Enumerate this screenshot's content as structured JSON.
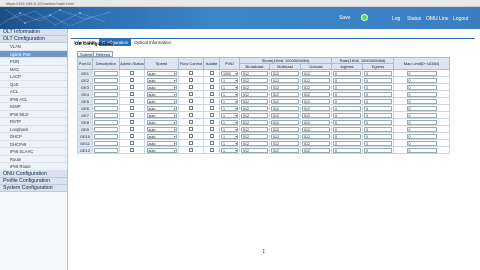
{
  "browser": {
    "url": "https://192.168.8.100/action/main.html"
  },
  "banner": {
    "state_label": "Save",
    "links": [
      "Log",
      "Status",
      "OMU Line",
      "Logout"
    ]
  },
  "sidebar": [
    {
      "label": "OLT Information",
      "type": "group"
    },
    {
      "label": "OLT Configuration",
      "type": "group"
    },
    {
      "label": "VLAN",
      "type": "item"
    },
    {
      "label": "Uplink Port",
      "type": "item",
      "active": true
    },
    {
      "label": "PON",
      "type": "item"
    },
    {
      "label": "MAC",
      "type": "item"
    },
    {
      "label": "LACP",
      "type": "item"
    },
    {
      "label": "QoS",
      "type": "item"
    },
    {
      "label": "ACL",
      "type": "item"
    },
    {
      "label": "IPv6 ACL",
      "type": "item"
    },
    {
      "label": "IGMP",
      "type": "item"
    },
    {
      "label": "IPv6 MLD",
      "type": "item"
    },
    {
      "label": "RSTP",
      "type": "item"
    },
    {
      "label": "Loopback",
      "type": "item"
    },
    {
      "label": "DHCP",
      "type": "item"
    },
    {
      "label": "DHCPv6",
      "type": "item"
    },
    {
      "label": "IPv6 SLAAC",
      "type": "item"
    },
    {
      "label": "Route",
      "type": "item"
    },
    {
      "label": "IPv6 Route",
      "type": "item"
    },
    {
      "label": "ONU Configuration",
      "type": "group"
    },
    {
      "label": "Profile Configuration",
      "type": "group"
    },
    {
      "label": "System Configuration",
      "type": "group"
    }
  ],
  "tabs": [
    {
      "label": "Information",
      "active": false
    },
    {
      "label": "Configuration",
      "active": true
    },
    {
      "label": "Optical Information",
      "active": false
    }
  ],
  "page_title": "GE Configuration",
  "buttons": {
    "submit": "Submit",
    "refresh": "Refresh"
  },
  "table": {
    "headers": [
      "Port ID",
      "Description",
      "Admin Status",
      "Speed",
      "Flow Control",
      "Isolate",
      "PVID",
      "Storm(1Kbit, 1000000Mbit)",
      "Rate(1Kbit, 1000000Mbit)",
      "Mac Limit(0~16384)"
    ],
    "subheaders": [
      "Broadcast",
      "Multicast",
      "Unicast",
      "Ingress",
      "Egress"
    ],
    "rows": [
      {
        "port": "GE1",
        "speed": "auto",
        "pvid": "1000",
        "bc": "512",
        "mc": "512",
        "uc": "512",
        "ing": "0",
        "egr": "0",
        "mac": "0"
      },
      {
        "port": "GE2",
        "speed": "auto",
        "pvid": "1",
        "bc": "512",
        "mc": "512",
        "uc": "512",
        "ing": "0",
        "egr": "0",
        "mac": "0"
      },
      {
        "port": "GE3",
        "speed": "auto",
        "pvid": "1",
        "bc": "512",
        "mc": "512",
        "uc": "512",
        "ing": "0",
        "egr": "0",
        "mac": "0"
      },
      {
        "port": "GE4",
        "speed": "auto",
        "pvid": "1",
        "bc": "512",
        "mc": "512",
        "uc": "512",
        "ing": "0",
        "egr": "0",
        "mac": "0"
      },
      {
        "port": "GE5",
        "speed": "auto",
        "pvid": "1",
        "bc": "512",
        "mc": "512",
        "uc": "512",
        "ing": "0",
        "egr": "0",
        "mac": "0"
      },
      {
        "port": "GE6",
        "speed": "auto",
        "pvid": "1",
        "bc": "512",
        "mc": "512",
        "uc": "512",
        "ing": "0",
        "egr": "0",
        "mac": "0"
      },
      {
        "port": "GE7",
        "speed": "auto",
        "pvid": "1",
        "bc": "512",
        "mc": "512",
        "uc": "512",
        "ing": "0",
        "egr": "0",
        "mac": "0"
      },
      {
        "port": "GE8",
        "speed": "auto",
        "pvid": "1",
        "bc": "512",
        "mc": "512",
        "uc": "512",
        "ing": "0",
        "egr": "0",
        "mac": "0"
      },
      {
        "port": "GE9",
        "speed": "auto",
        "pvid": "1",
        "bc": "512",
        "mc": "512",
        "uc": "512",
        "ing": "0",
        "egr": "0",
        "mac": "0"
      },
      {
        "port": "GE10",
        "speed": "auto",
        "pvid": "1",
        "bc": "512",
        "mc": "512",
        "uc": "512",
        "ing": "0",
        "egr": "0",
        "mac": "0"
      },
      {
        "port": "GE11",
        "speed": "auto",
        "pvid": "1",
        "bc": "512",
        "mc": "512",
        "uc": "512",
        "ing": "0",
        "egr": "0",
        "mac": "0"
      },
      {
        "port": "GE12",
        "speed": "auto",
        "pvid": "1",
        "bc": "512",
        "mc": "512",
        "uc": "512",
        "ing": "0",
        "egr": "0",
        "mac": "0"
      }
    ]
  },
  "colors": {
    "banner": "#2c6db1",
    "accent": "#2e6eb3",
    "status_ok": "#5fd35b",
    "sidebar_active": "#6f98c9"
  }
}
